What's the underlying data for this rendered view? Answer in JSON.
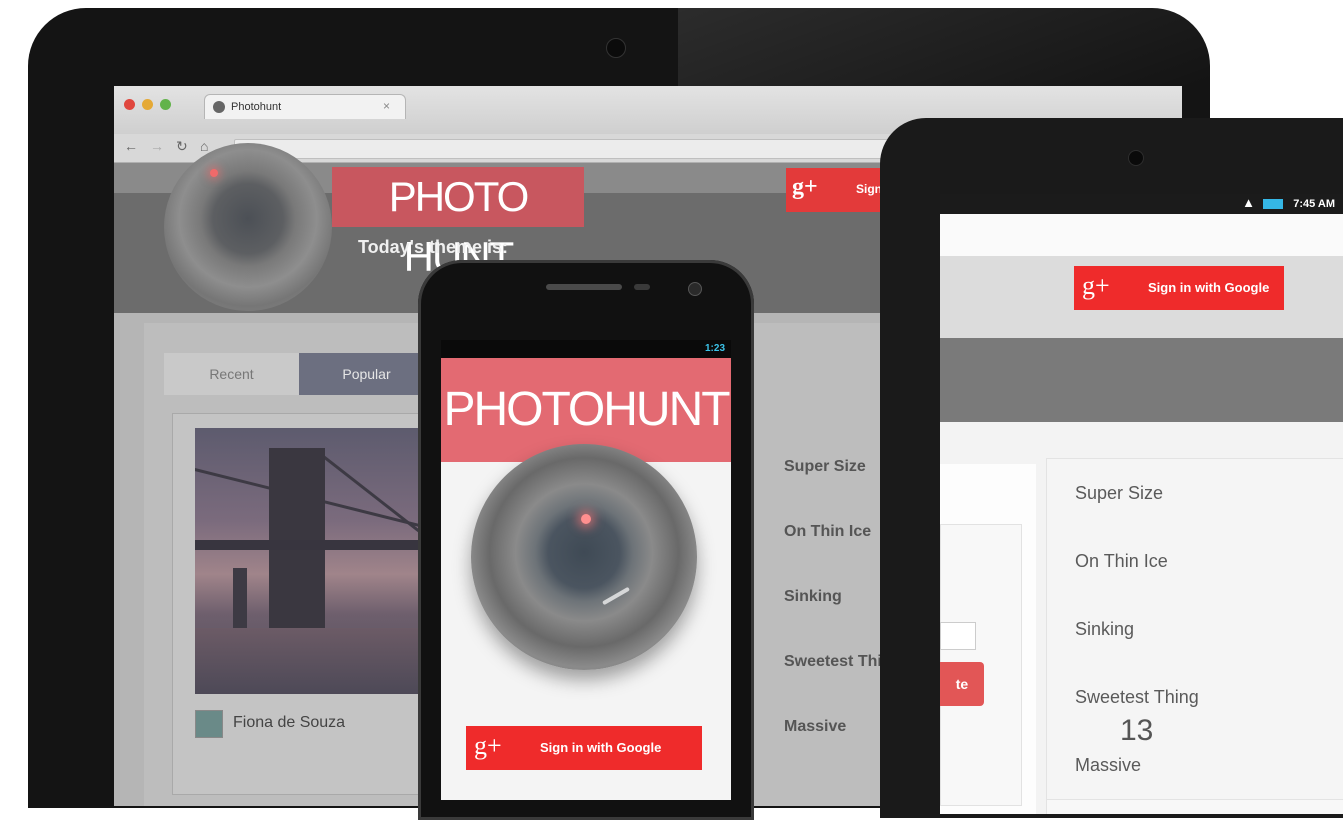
{
  "laptop": {
    "browser": {
      "tab_title": "Photohunt",
      "tab_close": "×"
    },
    "app_title": "PHOTO HUNT",
    "theme_label": "Today's theme is:",
    "signin": {
      "g": "g+",
      "label": "Sign in"
    },
    "tabs": [
      {
        "label": "Recent",
        "active": false
      },
      {
        "label": "Popular",
        "active": true
      }
    ],
    "photo_author": "Fiona de Souza",
    "topics": [
      "Super Size",
      "On Thin Ice",
      "Sinking",
      "Sweetest Thin",
      "Massive"
    ]
  },
  "phone": {
    "status_time": "1:23",
    "app_title": "PHOTOHUNT",
    "signin": {
      "g": "g+",
      "label": "Sign in with Google"
    }
  },
  "tablet": {
    "status_time": "7:45 AM",
    "signin": {
      "g": "g+",
      "label": "Sign in with Google"
    },
    "partial_button": "te",
    "topics": [
      "Super Size",
      "On Thin Ice",
      "Sinking",
      "Sweetest Thing",
      "Massive"
    ]
  },
  "slide_number": "13",
  "colors": {
    "brand_red": "#ef2b2b",
    "title_pink": "#e36a72"
  }
}
